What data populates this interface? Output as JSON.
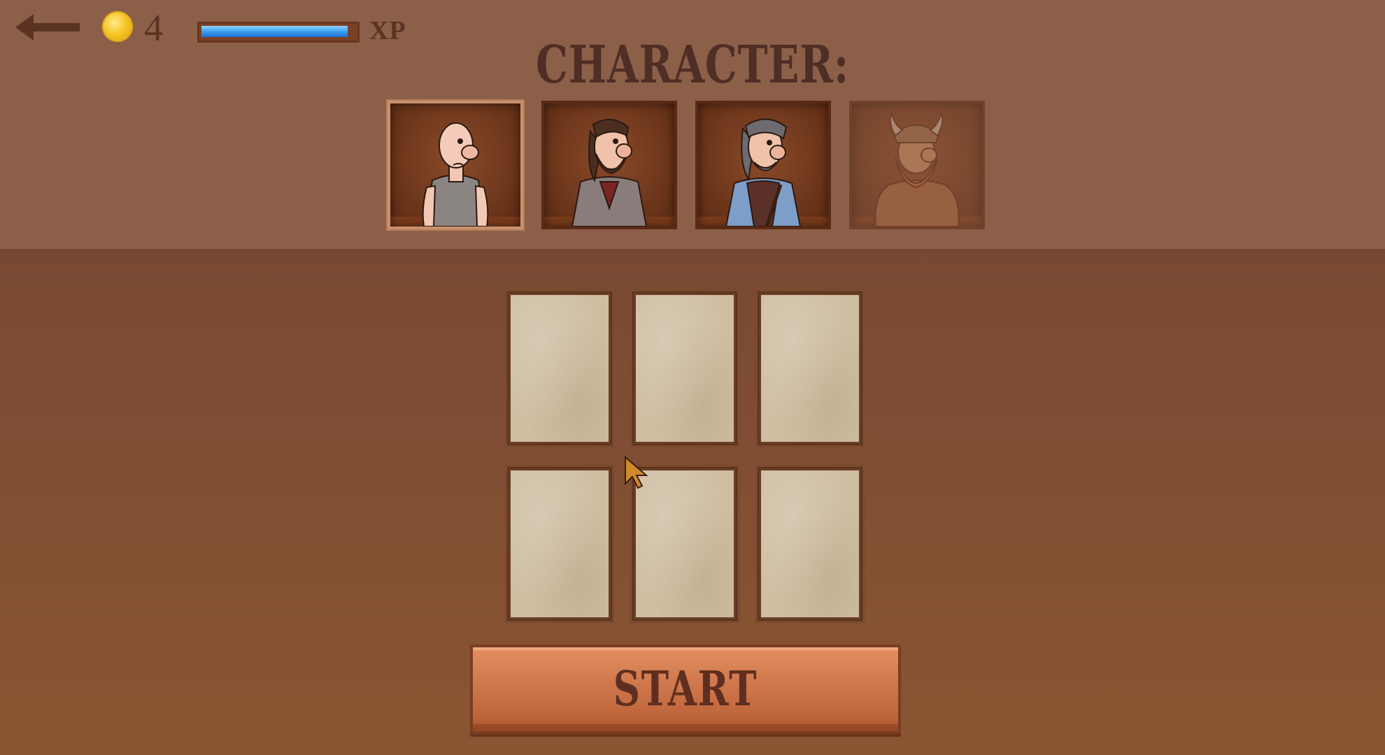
{
  "hud": {
    "back_icon": "arrow-left-icon",
    "coin_icon": "gold-coin-icon",
    "coins": "4",
    "xp_label": "XP",
    "xp_progress": 0.95
  },
  "title": "CHARACTER:",
  "characters": [
    {
      "id": "bald-man",
      "selected": true,
      "locked": false
    },
    {
      "id": "bearded-man",
      "selected": false,
      "locked": false
    },
    {
      "id": "grey-haired-man",
      "selected": false,
      "locked": false
    },
    {
      "id": "viking",
      "selected": false,
      "locked": true
    }
  ],
  "card_slots": 6,
  "start_button": {
    "label": "START"
  },
  "colors": {
    "background": "#8c5f48",
    "text": "#4e2e25",
    "xp_fill": "#3aa0ef",
    "start_plank": "#d1794e"
  }
}
